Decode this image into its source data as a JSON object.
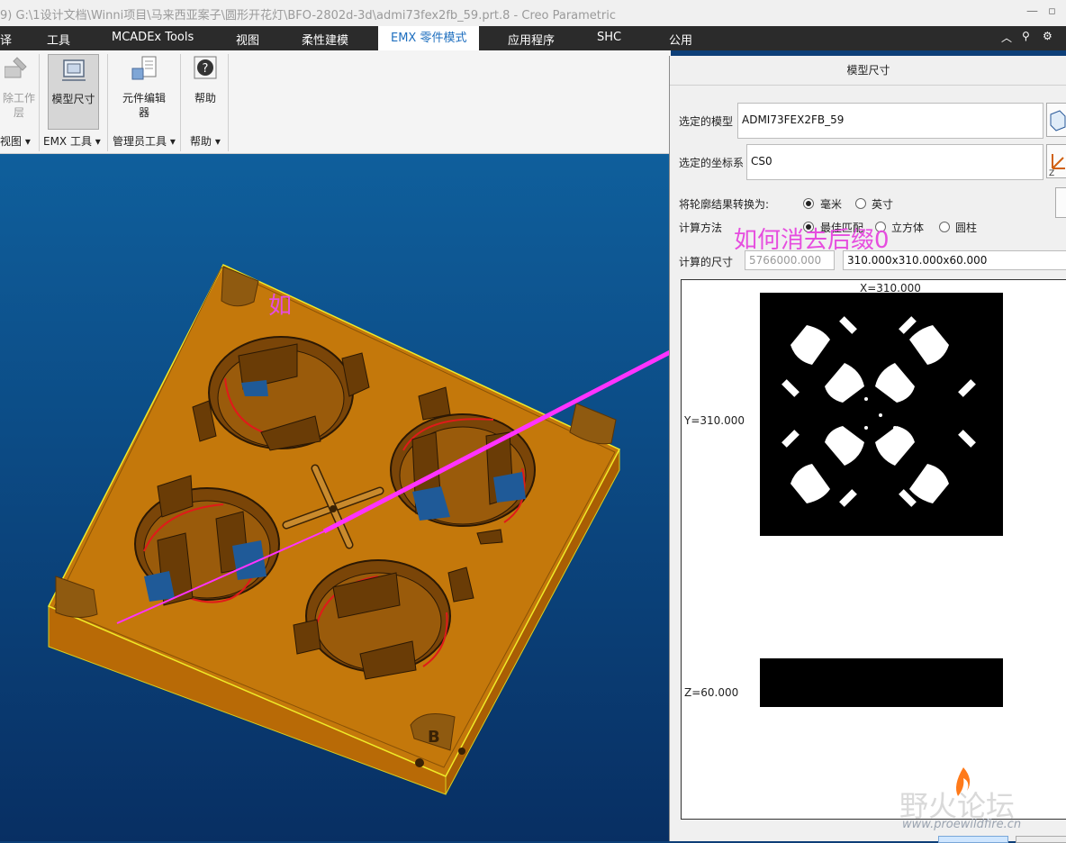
{
  "window": {
    "title": "9) G:\\1设计文档\\Winni项目\\马来西亚案子\\圆形开花灯\\BFO-2802d-3d\\admi73fex2fb_59.prt.8 - Creo Parametric"
  },
  "menu": {
    "tabs": [
      "译",
      "工具",
      "MCADEx Tools",
      "视图",
      "柔性建模",
      "EMX 零件模式",
      "应用程序",
      "SHC",
      "公用"
    ]
  },
  "ribbon": {
    "btn_remove_layer": "除工作\n层",
    "btn_model_size": "模型尺寸",
    "btn_component_editor": "元件编辑\n器",
    "btn_help": "帮助",
    "groups": [
      "视图",
      "EMX 工具",
      "管理员工具",
      "帮助"
    ]
  },
  "dialog": {
    "title": "模型尺寸",
    "selected_model_label": "选定的模型",
    "selected_model_value": "ADMI73FEX2FB_59",
    "selected_csys_label": "选定的坐标系",
    "selected_csys_value": "CS0",
    "convert_label": "将轮廓结果转换为:",
    "unit_mm": "毫米",
    "unit_inch": "英寸",
    "method_label": "计算方法",
    "method_best": "最佳匹配",
    "method_cube": "立方体",
    "method_cylinder": "圆柱",
    "computed_label": "计算的尺寸",
    "computed_volume": "5766000.000",
    "computed_dims": "310.000x310.000x60.000",
    "x_label": "X=310.000",
    "y_label": "Y=310.000",
    "z_label": "Z=60.000"
  },
  "annotations": {
    "question": "如何消去后缀0",
    "char": "如"
  },
  "model": {
    "corner_letter": "B"
  },
  "watermark": {
    "cn": "野火论坛",
    "url": "www.proewildfire.cn"
  },
  "colors": {
    "part": "#c4780b",
    "annotation": "#e64ddf",
    "viewport_top": "#0f5f9c",
    "viewport_bottom": "#082f63"
  }
}
